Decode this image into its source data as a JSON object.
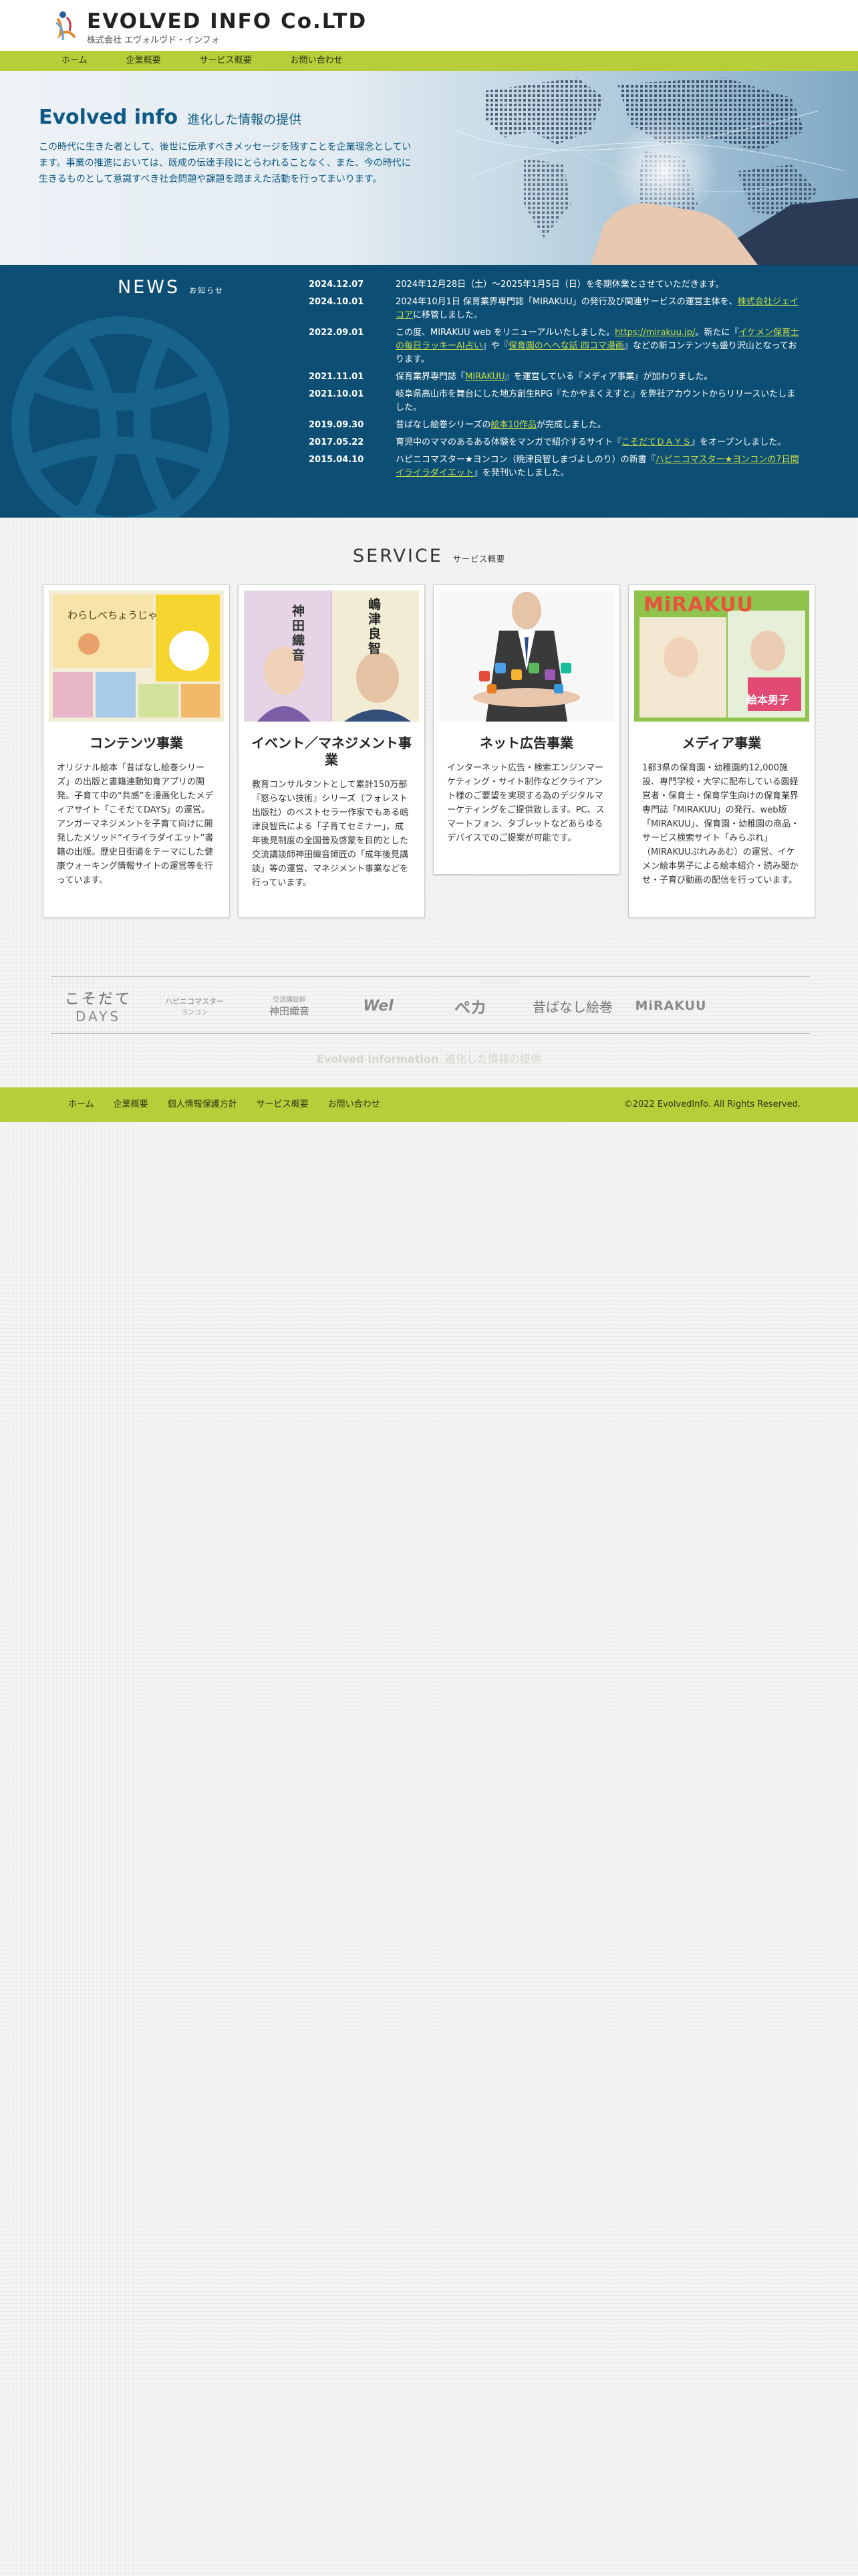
{
  "header": {
    "logo_name": "EVOLVED INFO Co.LTD",
    "logo_sub": "株式会社 エヴォルヴド・インフォ"
  },
  "nav": [
    "ホーム",
    "企業概要",
    "サービス概要",
    "お問い合わせ"
  ],
  "hero": {
    "title_en": "Evolved info",
    "title_jp": "進化した情報の提供",
    "description": "この時代に生きた者として、後世に伝承すべきメッセージを残すことを企業理念としています。事業の推進においては、既成の伝達手段にとらわれることなく、また、今の時代に生きるものとして意識すべき社会問題や課題を踏まえた活動を行ってまいります。"
  },
  "news": {
    "title_en": "NEWS",
    "title_jp": "お知らせ",
    "items": [
      {
        "date": "2024.12.07",
        "parts": [
          "2024年12月28日（土）〜2025年1月5日（日）を冬期休業とさせていただきます。"
        ]
      },
      {
        "date": "2024.10.01",
        "parts": [
          "2024年10月1日 保育業界専門誌「MIRAKUU」の発行及び関連サービスの運営主体を、",
          "株式会社ジェイコア",
          "に移管しました。"
        ]
      },
      {
        "date": "2022.09.01",
        "parts": [
          "この度、MIRAKUU web をリニューアルいたしました。",
          "https://mirakuu.jp/",
          "。新たに『",
          "イケメン保育士の毎日ラッキーAI占い",
          "』や『",
          "保育園のへへな話 四コマ漫画",
          "』などの新コンテンツも盛り沢山となっております。"
        ]
      },
      {
        "date": "2021.11.01",
        "parts": [
          "保育業界専門誌『",
          "MIRAKUU",
          "』を運営している『メディア事業』が加わりました。"
        ]
      },
      {
        "date": "2021.10.01",
        "parts": [
          "岐阜県高山市を舞台にした地方創生RPG『たかやまくえすと』を弊社アカウントからリリースいたしました。"
        ]
      },
      {
        "date": "2019.09.30",
        "parts": [
          "昔ばなし絵巻シリーズの",
          "絵本10作品",
          "が完成しました。"
        ]
      },
      {
        "date": "2017.05.22",
        "parts": [
          "育児中のママのあるある体験をマンガで紹介するサイト『",
          "こそだてＤＡＹＳ",
          "』をオープンしました。"
        ]
      },
      {
        "date": "2015.04.10",
        "parts": [
          "ハピニコマスター★ヨンコン（晩津良智しまづよしのり）の新書『",
          "ハピニコマスター★ヨンコンの7日間イライラダイエット",
          "』を発刊いたしました。"
        ]
      }
    ]
  },
  "service": {
    "title_en": "SERVICE",
    "title_jp": "サービス概要",
    "cards": [
      {
        "title": "コンテンツ事業",
        "text": "オリジナル絵本「昔ばなし絵巻シリーズ」の出版と書籍連動知育アプリの開発。子育て中の“共感”を漫画化したメディアサイト「こそだてDAYS」の運営。アンガーマネジメントを子育て向けに開発したメソッド“イライラダイエット”書籍の出版。歴史日街道をテーマにした健康ウォーキング情報サイトの運営等を行っています。",
        "img_text": "わらしべちょうじゃ"
      },
      {
        "title": "イベント／マネジメント事業",
        "text": "教育コンサルタントとして累計150万部『怒らない技術』シリーズ（フォレスト出版社）のベストセラー作家でもある嶋津良智氏による「子育てセミナー」、成年後見制度の全国普及啓蒙を目的とした交流講談師神田織音師匠の「成年後見講談」等の運営、マネジメント事業などを行っています。",
        "img_left": "神田織音",
        "img_right": "嶋津良智"
      },
      {
        "title": "ネット広告事業",
        "text": "インターネット広告・検索エンジンマーケティング・サイト制作などクライアント様のご要望を実現する為のデジタルマーケティングをご提供致します。PC、スマートフォン、タブレットなどあらゆるデバイスでのご提案が可能です。"
      },
      {
        "title": "メディア事業",
        "text": "1都3県の保育園・幼稚園約12,000施設、専門学校・大学に配布している園経営者・保育士・保育学生向けの保育業界専門誌「MIRAKUU」の発行、web版「MIRAKUU」、保育園・幼稚園の商品・サービス検索サイト「みらぷれ」（MIRAKUUぷれみあむ）の運営、イケメン絵本男子による絵本紹介・読み聞かせ・子育び動画の配信を行っています。",
        "img_logo": "MiRAKUU",
        "img_book": "絵本男子"
      }
    ]
  },
  "partners": [
    "こそだて",
    "DAYS",
    "ハピニコマスター",
    "ヨンコン",
    "交流講談師",
    "神田織音",
    "Wel",
    "ペカ",
    "昔ばなし絵巻",
    "MiRAKUU"
  ],
  "tagline": {
    "en": "Evolved Information",
    "jp": "進化した情報の提供"
  },
  "footer": {
    "links": [
      "ホーム",
      "企業概要",
      "個人情報保護方針",
      "サービス概要",
      "お問い合わせ"
    ],
    "copyright": "©2022 EvolvedInfo. All Rights Reserved."
  },
  "colors": {
    "accent_green": "#b7cd3a",
    "navy": "#0d4f74",
    "hero_text": "#0f5a85",
    "link": "#c8dc4a"
  }
}
